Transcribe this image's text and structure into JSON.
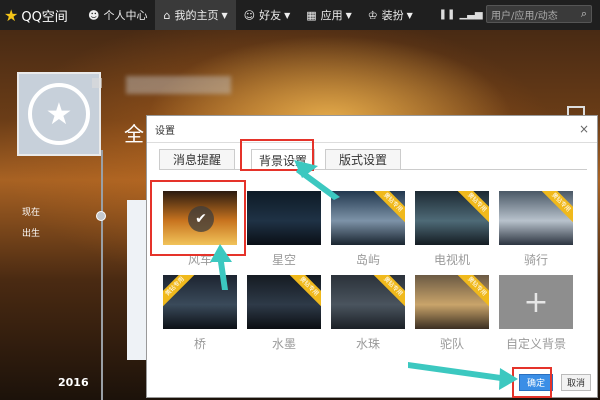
{
  "topbar": {
    "logo_text": "QQ空间",
    "nav": [
      {
        "icon": "user-icon",
        "label": "个人中心"
      },
      {
        "icon": "home-icon",
        "label": "我的主页",
        "active": true
      },
      {
        "icon": "friends-icon",
        "label": "好友"
      },
      {
        "icon": "apps-icon",
        "label": "应用"
      },
      {
        "icon": "shirt-icon",
        "label": "装扮"
      }
    ],
    "search_placeholder": "用户/应用/动态"
  },
  "profile": {
    "big_char": "全",
    "side_text_1": "现在",
    "side_text_2": "出生",
    "year": "2016"
  },
  "modal": {
    "title": "设置",
    "close": "×",
    "tabs": [
      "消息提醒",
      "背景设置",
      "版式设置"
    ],
    "active_tab": "背景设置",
    "ribbon_text": "黄钻专用",
    "thumbnails": [
      {
        "label": "风车",
        "selected": true,
        "vip": false,
        "colors": [
          "#2a1a10",
          "#c8741f",
          "#f1c35a"
        ]
      },
      {
        "label": "星空",
        "selected": false,
        "vip": false,
        "colors": [
          "#0d1a26",
          "#1f3245",
          "#0a0f16"
        ]
      },
      {
        "label": "岛屿",
        "selected": false,
        "vip": true,
        "colors": [
          "#22384f",
          "#7d93a8",
          "#1a2530"
        ]
      },
      {
        "label": "电视机",
        "selected": false,
        "vip": true,
        "colors": [
          "#1d2a33",
          "#4e6a77",
          "#141c22"
        ]
      },
      {
        "label": "骑行",
        "selected": false,
        "vip": true,
        "colors": [
          "#4a5866",
          "#b8c2cc",
          "#2c3440"
        ]
      },
      {
        "label": "桥",
        "selected": false,
        "vip": true,
        "colors": [
          "#1c2430",
          "#3a4a5a",
          "#0c1016"
        ]
      },
      {
        "label": "水墨",
        "selected": false,
        "vip": true,
        "colors": [
          "#151b22",
          "#2e3a48",
          "#0b0e12"
        ]
      },
      {
        "label": "水珠",
        "selected": false,
        "vip": true,
        "colors": [
          "#2b323a",
          "#4a545e",
          "#1b2026"
        ]
      },
      {
        "label": "驼队",
        "selected": false,
        "vip": true,
        "colors": [
          "#6b5a44",
          "#c9a46a",
          "#3b2f22"
        ]
      },
      {
        "label": "自定义背景",
        "selected": false,
        "vip": false,
        "custom": true
      }
    ],
    "ok_label": "确定",
    "cancel_label": "取消"
  },
  "colors": {
    "highlight": "#e5332a",
    "arrow": "#3cc8c0",
    "primary_button": "#3a8ee6",
    "vip_ribbon": "#f0b91c"
  }
}
